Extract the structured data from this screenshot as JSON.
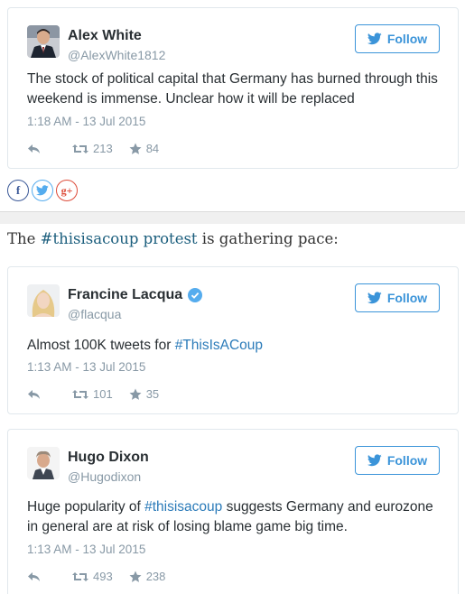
{
  "tweets": [
    {
      "name": "Alex White",
      "handle": "@AlexWhite1812",
      "follow_label": "Follow",
      "text_parts": [
        "The stock of political capital that Germany has burned through this weekend is immense. Unclear how it will be replaced"
      ],
      "time": "1:18 AM - 13 Jul 2015",
      "retweets": "213",
      "favorites": "84",
      "verified": false
    },
    {
      "name": "Francine Lacqua",
      "handle": "@flacqua",
      "follow_label": "Follow",
      "text_parts": [
        "Almost 100K tweets for ",
        "#ThisIsACoup"
      ],
      "time": "1:13 AM - 13 Jul 2015",
      "retweets": "101",
      "favorites": "35",
      "verified": true
    },
    {
      "name": "Hugo Dixon",
      "handle": "@Hugodixon",
      "follow_label": "Follow",
      "text_parts": [
        "Huge popularity of ",
        "#thisisacoup",
        " suggests Germany and eurozone in general are at risk of losing blame game big time."
      ],
      "time": "1:13 AM - 13 Jul 2015",
      "retweets": "493",
      "favorites": "238",
      "verified": false
    }
  ],
  "share": {
    "facebook": "f",
    "twitter": "twitter-bird-icon",
    "googleplus": "g+"
  },
  "lead": {
    "before": "The ",
    "link": "#thisisacoup protest",
    "after": " is gathering pace:"
  },
  "colors": {
    "link": "#2b7bb9",
    "follow": "#3b94d9",
    "muted": "#8899a6",
    "verified": "#55acee"
  }
}
